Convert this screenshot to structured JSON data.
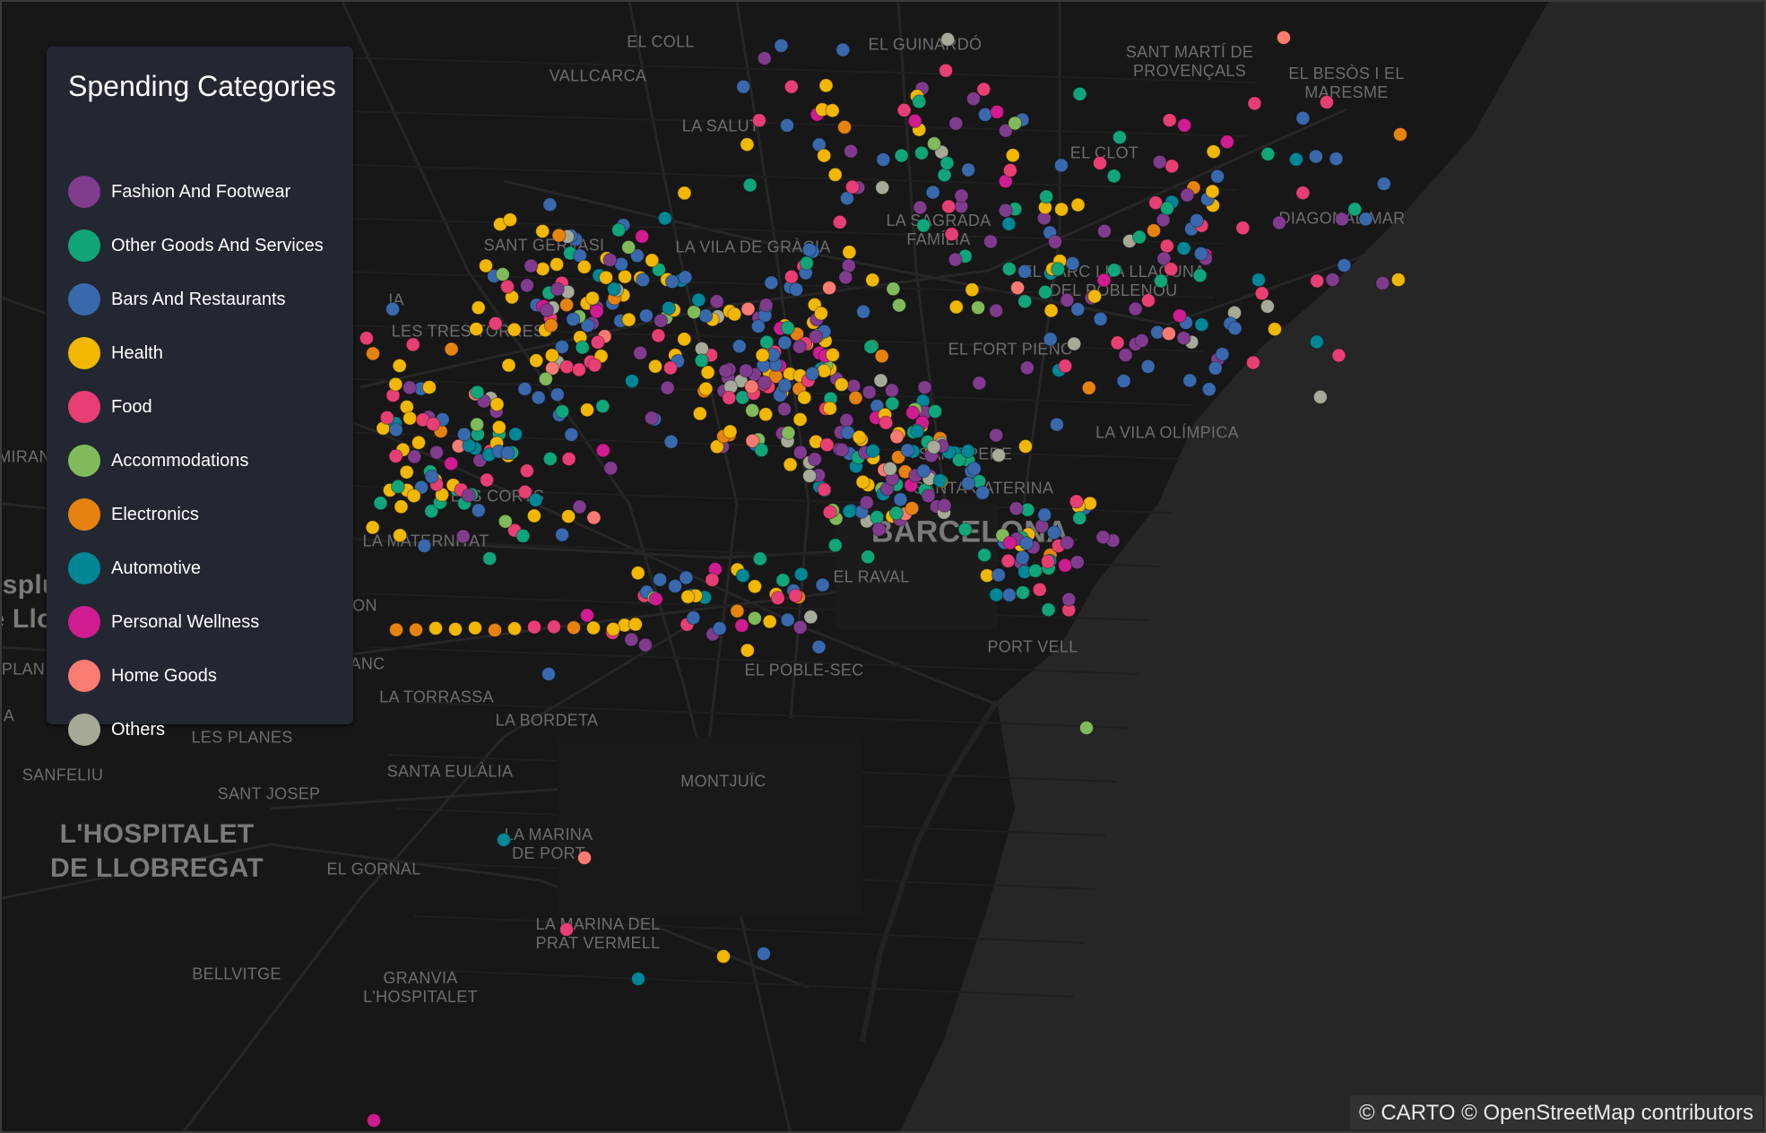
{
  "legend": {
    "title": "Spending Categories",
    "items": [
      {
        "label": "Fashion And Footwear",
        "color": "#7f3c8d"
      },
      {
        "label": "Other Goods And Services",
        "color": "#11a579"
      },
      {
        "label": "Bars And Restaurants",
        "color": "#3969ac"
      },
      {
        "label": "Health",
        "color": "#f2b701"
      },
      {
        "label": "Food",
        "color": "#e73f74"
      },
      {
        "label": "Accommodations",
        "color": "#80ba5a"
      },
      {
        "label": "Electronics",
        "color": "#e68310"
      },
      {
        "label": "Automotive",
        "color": "#008695"
      },
      {
        "label": "Personal Wellness",
        "color": "#cf1c90"
      },
      {
        "label": "Home Goods",
        "color": "#f97b72"
      },
      {
        "label": "Others",
        "color": "#a5aa99"
      }
    ]
  },
  "map": {
    "basemap_style": "dark",
    "place_labels": [
      {
        "text": "EL COLL",
        "kind": "district"
      },
      {
        "text": "EL GUINARDÓ",
        "kind": "district"
      },
      {
        "text": "SANT MARTÍ DE\nPROVENÇALS",
        "kind": "district"
      },
      {
        "text": "EL BESÒS I EL\nMARESME",
        "kind": "district"
      },
      {
        "text": "VALLCARCA",
        "kind": "district"
      },
      {
        "text": "LA SALUT",
        "kind": "district"
      },
      {
        "text": "EL CLOT",
        "kind": "district"
      },
      {
        "text": "LA SAGRADA\nFAMÍLIA",
        "kind": "district"
      },
      {
        "text": "DIAGONAL MAR",
        "kind": "district"
      },
      {
        "text": "SANT GERVASI",
        "kind": "district"
      },
      {
        "text": "LA VILA DE GRÀCIA",
        "kind": "district"
      },
      {
        "text": "EL PARC I LA LLACUNA\nDEL POBLENOU",
        "kind": "district"
      },
      {
        "text": "LES TRES TORRES",
        "kind": "district"
      },
      {
        "text": "EL FORT PIENC",
        "kind": "district"
      },
      {
        "text": "SANT PERE",
        "kind": "district"
      },
      {
        "text": "LA VILA OLÍMPICA",
        "kind": "district"
      },
      {
        "text": "SANTA CATERINA",
        "kind": "district"
      },
      {
        "text": "LES CORTS",
        "kind": "district"
      },
      {
        "text": "LA MATERNITAT",
        "kind": "district"
      },
      {
        "text": "BARCELONA",
        "kind": "city"
      },
      {
        "text": "EL RAVAL",
        "kind": "district"
      },
      {
        "text": "PORT VELL",
        "kind": "district"
      },
      {
        "text": "EL POBLE-SEC",
        "kind": "district"
      },
      {
        "text": "LA TORRASSA",
        "kind": "district"
      },
      {
        "text": "LA BORDETA",
        "kind": "district"
      },
      {
        "text": "LES PLANES",
        "kind": "district"
      },
      {
        "text": "SANFELIU",
        "kind": "district"
      },
      {
        "text": "SANTA EULÀLIA",
        "kind": "district"
      },
      {
        "text": "SANT JOSEP",
        "kind": "district"
      },
      {
        "text": "MONTJUÏC",
        "kind": "district"
      },
      {
        "text": "L'HOSPITALET\nDE LLOBREGAT",
        "kind": "big"
      },
      {
        "text": "EL GORNAL",
        "kind": "district"
      },
      {
        "text": "LA MARINA\nDE PORT",
        "kind": "district"
      },
      {
        "text": "LA MARINA DEL\nPRAT VERMELL",
        "kind": "district"
      },
      {
        "text": "BELLVITGE",
        "kind": "district"
      },
      {
        "text": "GRANVIA\nL'HOSPITALET",
        "kind": "district"
      },
      {
        "text": "IA",
        "kind": "district"
      },
      {
        "text": "MIRAN",
        "kind": "district"
      },
      {
        "text": "ON",
        "kind": "district"
      },
      {
        "text": "ANC",
        "kind": "district"
      },
      {
        "text": "PLAN",
        "kind": "district"
      },
      {
        "text": "A",
        "kind": "district"
      },
      {
        "text": "Esplu\ne Llo",
        "kind": "big"
      }
    ]
  },
  "attribution": "© CARTO © OpenStreetMap contributors"
}
